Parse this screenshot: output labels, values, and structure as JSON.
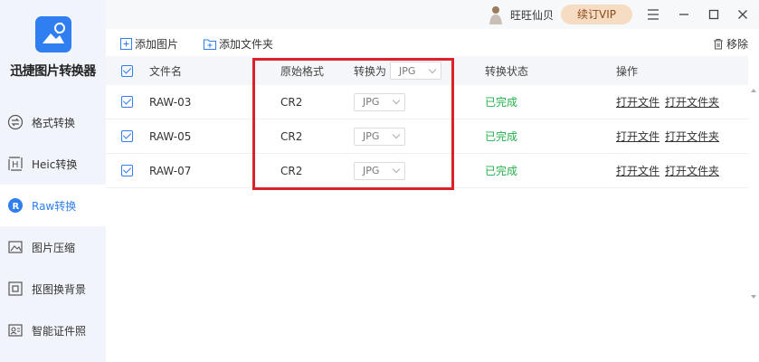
{
  "app": {
    "name": "迅捷图片转换器",
    "accent_color": "#2f7ff1",
    "logo_icon": "image-convert-logo-icon"
  },
  "sidebar": {
    "items": [
      {
        "label": "格式转换",
        "icon": "format-convert-icon",
        "active": false
      },
      {
        "label": "Heic转换",
        "icon": "heic-icon",
        "active": false
      },
      {
        "label": "Raw转换",
        "icon": "raw-icon",
        "active": true
      },
      {
        "label": "图片压缩",
        "icon": "image-compress-icon",
        "active": false
      },
      {
        "label": "抠图换背景",
        "icon": "cutout-icon",
        "active": false
      },
      {
        "label": "智能证件照",
        "icon": "id-photo-icon",
        "active": false
      }
    ]
  },
  "topbar": {
    "username": "旺旺仙贝",
    "vip_label": "续订VIP"
  },
  "toolbar": {
    "add_image": "添加图片",
    "add_folder": "添加文件夹",
    "remove": "移除"
  },
  "table": {
    "headers": {
      "filename": "文件名",
      "original_format": "原始格式",
      "convert_to": "转换为",
      "convert_to_value": "JPG",
      "status": "转换状态",
      "actions": "操作"
    },
    "rows": [
      {
        "filename": "RAW-03",
        "format": "CR2",
        "target": "JPG",
        "status": "已完成",
        "open_file": "打开文件",
        "open_folder": "打开文件夹",
        "checked": true
      },
      {
        "filename": "RAW-05",
        "format": "CR2",
        "target": "JPG",
        "status": "已完成",
        "open_file": "打开文件",
        "open_folder": "打开文件夹",
        "checked": true
      },
      {
        "filename": "RAW-07",
        "format": "CR2",
        "target": "JPG",
        "status": "已完成",
        "open_file": "打开文件",
        "open_folder": "打开文件夹",
        "checked": true
      }
    ]
  },
  "colors": {
    "status_done": "#23b04a",
    "highlight_border": "#d9222a",
    "vip_bg": "#f7dcc4"
  }
}
